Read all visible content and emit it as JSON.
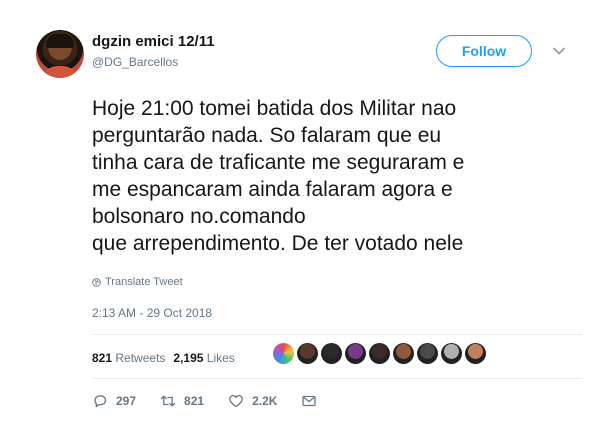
{
  "user": {
    "display_name": "dgzin emici 12/11",
    "handle": "@DG_Barcellos"
  },
  "follow_label": "Follow",
  "tweet": {
    "text": "Hoje 21:00 tomei batida dos Militar nao\nperguntarão nada. So falaram que eu\ntinha cara de traficante me seguraram e\nme espancaram ainda falaram agora e\nbolsonaro no.comando\nque arrependimento. De ter votado nele",
    "translate_label": "Translate Tweet",
    "timestamp": "2:13 AM - 29 Oct 2018"
  },
  "stats": {
    "retweets_count": "821",
    "retweets_label": "Retweets",
    "likes_count": "2,195",
    "likes_label": "Likes"
  },
  "liker_avatar_colors": [
    "#e8e0c8",
    "#5a3a2a",
    "#2a2a2a",
    "#7a3a8a",
    "#3a2a2a",
    "#8a5a3a",
    "#4a4a4a",
    "#b0b0b0",
    "#c08060"
  ],
  "actions": {
    "replies": "297",
    "retweets": "821",
    "likes": "2.2K"
  },
  "colors": {
    "accent": "#1da1f2",
    "secondary_text": "#657786",
    "primary_text": "#14171a"
  }
}
